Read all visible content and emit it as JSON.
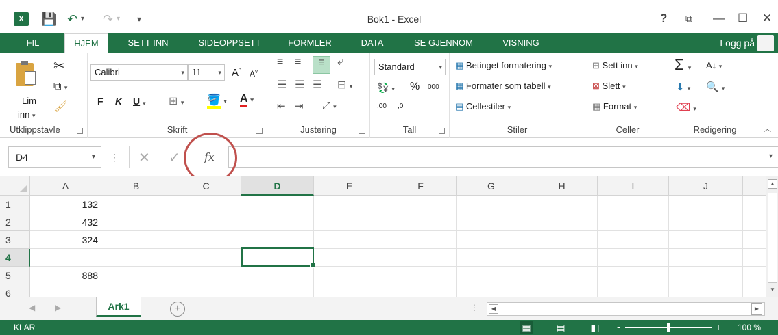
{
  "titlebar": {
    "app_icon": "X",
    "title": "Bok1 - Excel",
    "help": "?",
    "ribbon_options": "⧉",
    "minimize": "—",
    "maximize": "☐",
    "close": "✕"
  },
  "tabs": {
    "file": "FIL",
    "items": [
      "HJEM",
      "SETT INN",
      "SIDEOPPSETT",
      "FORMLER",
      "DATA",
      "SE GJENNOM",
      "VISNING"
    ],
    "active": "HJEM",
    "login": "Logg på"
  },
  "ribbon": {
    "clipboard": {
      "label": "Utklippstavle",
      "paste_label": "Lim",
      "paste_label2": "inn"
    },
    "font": {
      "label": "Skrift",
      "font_name": "Calibri",
      "font_size": "11",
      "bold": "F",
      "italic": "K",
      "underline": "U"
    },
    "alignment": {
      "label": "Justering"
    },
    "number": {
      "label": "Tall",
      "format": "Standard",
      "percent": "%",
      "thousands": "000",
      "inc_decimals": ",00",
      "dec_decimals": ",0"
    },
    "styles": {
      "label": "Stiler",
      "conditional": "Betinget formatering",
      "format_table": "Formater som tabell",
      "cell_styles": "Cellestiler"
    },
    "cells": {
      "label": "Celler",
      "insert": "Sett inn",
      "delete": "Slett",
      "format": "Format"
    },
    "editing": {
      "label": "Redigering"
    }
  },
  "formula_bar": {
    "name_box": "D4",
    "fx": "fx",
    "value": ""
  },
  "grid": {
    "columns": [
      "A",
      "B",
      "C",
      "D",
      "E",
      "F",
      "G",
      "H",
      "I",
      "J"
    ],
    "selected_column": "D",
    "rows": [
      "1",
      "2",
      "3",
      "4",
      "5",
      "6"
    ],
    "selected_row": "4",
    "column_a_values": [
      "132",
      "432",
      "324",
      "",
      "888",
      ""
    ]
  },
  "sheets": {
    "tabs": [
      "Ark1"
    ],
    "active": "Ark1",
    "add": "+"
  },
  "statusbar": {
    "status": "KLAR",
    "zoom": "100 %",
    "zoom_minus": "-",
    "zoom_plus": "+"
  },
  "colors": {
    "brand": "#217346",
    "annotation_circle": "#c0504d"
  }
}
